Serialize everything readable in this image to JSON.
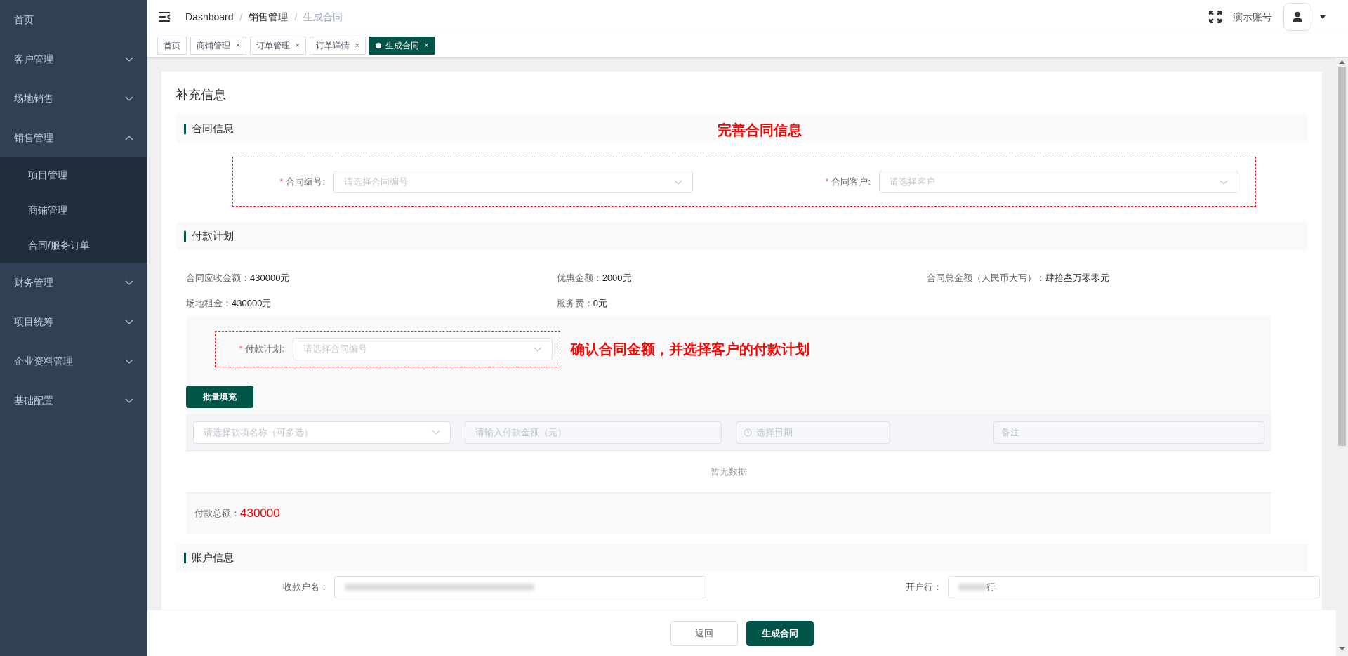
{
  "sidebar": {
    "items": [
      {
        "label": "首页"
      },
      {
        "label": "客户管理",
        "expandable": true,
        "expanded": false
      },
      {
        "label": "场地销售",
        "expandable": true,
        "expanded": false
      },
      {
        "label": "销售管理",
        "expandable": true,
        "expanded": true,
        "children": [
          {
            "label": "项目管理"
          },
          {
            "label": "商铺管理"
          },
          {
            "label": "合同/服务订单"
          }
        ]
      },
      {
        "label": "财务管理",
        "expandable": true,
        "expanded": false
      },
      {
        "label": "项目统筹",
        "expandable": true,
        "expanded": false
      },
      {
        "label": "企业资料管理",
        "expandable": true,
        "expanded": false
      },
      {
        "label": "基础配置",
        "expandable": true,
        "expanded": false
      }
    ]
  },
  "breadcrumb": [
    {
      "label": "Dashboard"
    },
    {
      "separator": "/",
      "label": "销售管理"
    },
    {
      "separator": "/",
      "label": "生成合同"
    }
  ],
  "user": {
    "name": "演示账号"
  },
  "tabs": [
    {
      "label": "首页",
      "selected": false
    },
    {
      "label": "商铺管理",
      "close": "×",
      "selected": false
    },
    {
      "label": "订单管理",
      "close": "×",
      "selected": false
    },
    {
      "label": "订单详情",
      "close": "×",
      "selected": false
    },
    {
      "label": "生成合同",
      "close": "×",
      "selected": true
    }
  ],
  "page_title": "补充信息",
  "contract_section": {
    "title": "合同信息",
    "annotation": "完善合同信息",
    "fields": [
      {
        "label": "合同编号:",
        "required_mark": "*",
        "placeholder": "请选择合同编号"
      },
      {
        "label": "合同客户:",
        "required_mark": "*",
        "placeholder": "请选择客户"
      }
    ]
  },
  "payment_section": {
    "title": "付款计划",
    "summary": [
      {
        "label": "合同应收金额：",
        "value": "430000元"
      },
      {
        "label": "优惠金额：",
        "value": "2000元"
      },
      {
        "label": "合同总金额（人民币大写）：",
        "value": "肆拾叁万零零元"
      },
      {
        "label": "场地租金：",
        "value": "430000元"
      },
      {
        "label": "服务费：",
        "value": "0元"
      }
    ],
    "plan_field": {
      "label": "付款计划:",
      "required_mark": "*",
      "placeholder": "请选择合同编号"
    },
    "annotation": "确认合同金额，并选择客户的付款计划",
    "batch_button": "批量填充",
    "batch_inputs": [
      {
        "kind": "select",
        "placeholder": "请选择款项名称（可多选）"
      },
      {
        "kind": "text",
        "placeholder": "请输入付款金额（元）"
      },
      {
        "kind": "date",
        "placeholder": "选择日期"
      },
      {
        "kind": "note",
        "placeholder": "备注"
      }
    ],
    "empty_text": "暂无数据",
    "total_label": "付款总额：",
    "total_value": "430000"
  },
  "account_section": {
    "title": "账户信息",
    "fields": [
      {
        "label": "收款户名："
      },
      {
        "label": "开户行：",
        "value": "行"
      }
    ]
  },
  "footer": {
    "buttons": [
      {
        "label": "返回",
        "kind": "secondary"
      },
      {
        "label": "生成合同",
        "kind": "primary"
      }
    ]
  }
}
